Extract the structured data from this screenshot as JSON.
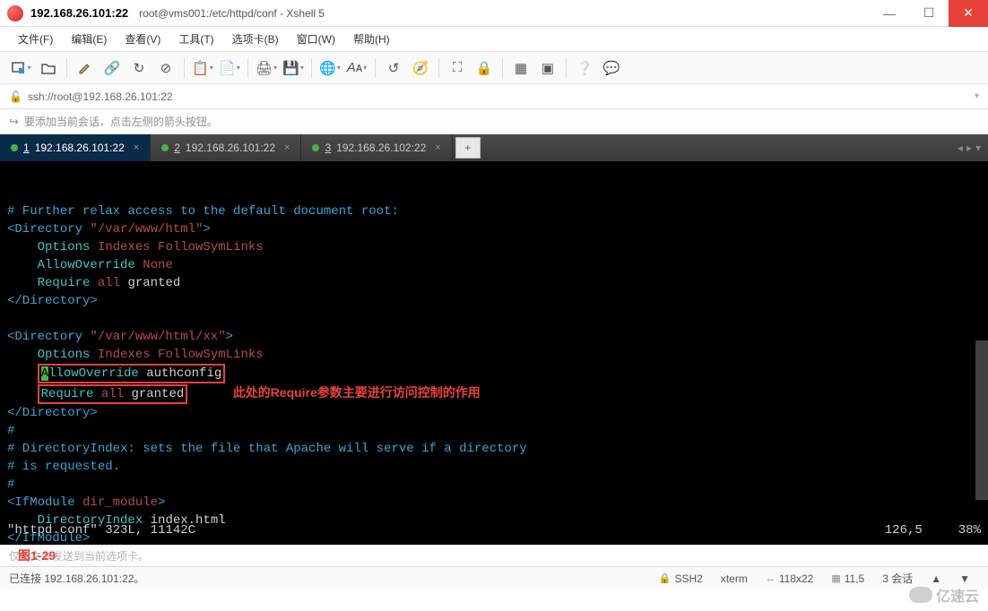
{
  "window": {
    "host": "192.168.26.101:22",
    "title_path": "root@vms001:/etc/httpd/conf - Xshell 5"
  },
  "menu": {
    "file": "文件(F)",
    "edit": "编辑(E)",
    "view": "查看(V)",
    "tools": "工具(T)",
    "tabs": "选项卡(B)",
    "window": "窗口(W)",
    "help": "帮助(H)"
  },
  "addressbar": {
    "url": "ssh://root@192.168.26.101:22"
  },
  "hint": {
    "text": "要添加当前会话，点击左侧的箭头按钮。"
  },
  "tabs": [
    {
      "index": "1",
      "label": "192.168.26.101:22",
      "active": true
    },
    {
      "index": "2",
      "label": "192.168.26.101:22",
      "active": false
    },
    {
      "index": "3",
      "label": "192.168.26.102:22",
      "active": false
    }
  ],
  "terminal": {
    "line1_comment": "# Further relax access to the default document root:",
    "dir1_open": "<Directory ",
    "dir1_path": "\"/var/www/html\"",
    "tag_close": ">",
    "options_kw": "Options",
    "indexes": "Indexes",
    "followsym": "FollowSymLinks",
    "allowoverride_kw": "AllowOverride",
    "none_val": "None",
    "require_kw": "Require",
    "all_kw": "all",
    "granted": "granted",
    "dir_close": "</Directory>",
    "dir2_path": "\"/var/www/html/xx\"",
    "authconfig": "authconfig",
    "annotation": "此处的Require参数主要进行访问控制的作用",
    "hash": "#",
    "diridx_comment1": "# DirectoryIndex: sets the file that Apache will serve if a directory",
    "diridx_comment2": "# is requested.",
    "ifmod_open": "<IfModule ",
    "dirmod": "dir_module",
    "diridx_kw": "DirectoryIndex",
    "indexhtml": "index.html",
    "ifmod_close": "</IfModule>",
    "status_file": "\"httpd.conf\" 323L, 11142C",
    "status_pos": "126,5",
    "status_pct": "38%"
  },
  "footer_hint": {
    "text": "仅将文本发送到当前选项卡。",
    "fig": "图1-29"
  },
  "statusbar": {
    "connected": "已连接 192.168.26.101:22。",
    "proto": "SSH2",
    "term": "xterm",
    "size": "118x22",
    "pos": "11,5",
    "sessions": "3 会话"
  },
  "watermark": "亿速云"
}
